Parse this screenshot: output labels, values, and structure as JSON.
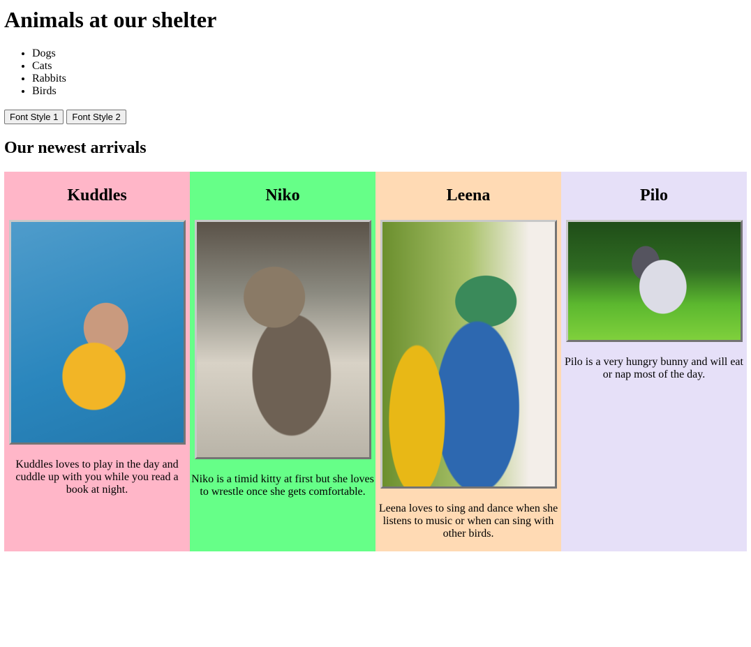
{
  "title": "Animals at our shelter",
  "categories": [
    "Dogs",
    "Cats",
    "Rabbits",
    "Birds"
  ],
  "buttons": [
    "Font Style 1",
    "Font Style 2"
  ],
  "subtitle": "Our newest arrivals",
  "animals": [
    {
      "name": "Kuddles",
      "color": "#FFB6C8",
      "image": "french-bulldog-in-yellow-hoodie",
      "description": "Kuddles loves to play in the day and cuddle up with you while you read a book at night."
    },
    {
      "name": "Niko",
      "color": "#66FF88",
      "image": "tabby-kitten",
      "description": "Niko is a timid kitty at first but she loves to wrestle once she gets comfortable."
    },
    {
      "name": "Leena",
      "color": "#FFDAB4",
      "image": "blue-and-yellow-macaw",
      "description": "Leena loves to sing and dance when she listens to music or when can sing with other birds."
    },
    {
      "name": "Pilo",
      "color": "#E6E0F8",
      "image": "grey-and-white-rabbit-in-grass",
      "description": "Pilo is a very hungry bunny and will eat or nap most of the day."
    }
  ]
}
